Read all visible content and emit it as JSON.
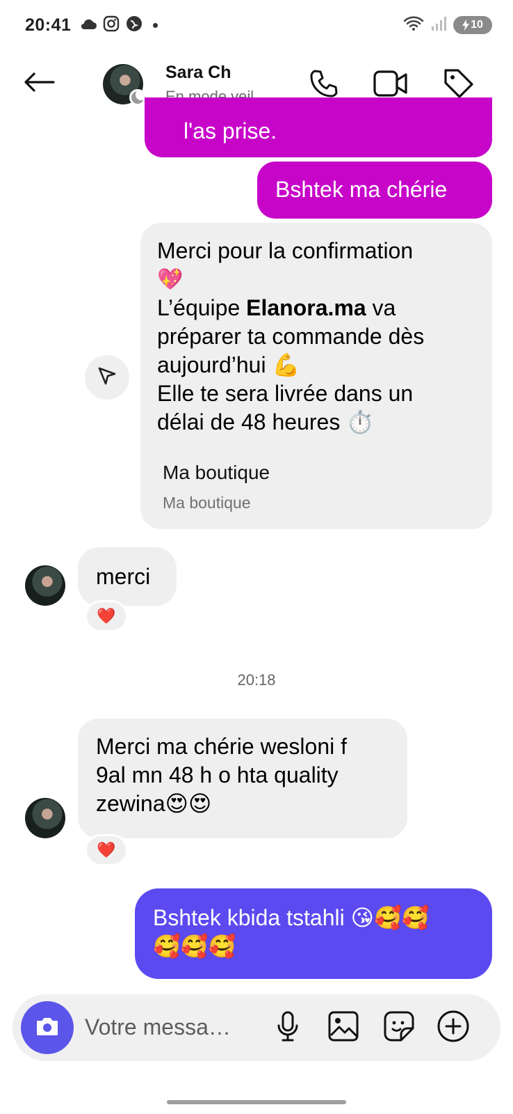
{
  "status_bar": {
    "time": "20:41",
    "battery": "10",
    "icons_left": [
      "cloud-icon",
      "instagram-icon",
      "vpn-icon"
    ],
    "icons_right": [
      "wifi-icon",
      "signal-icon",
      "battery-icon"
    ]
  },
  "header": {
    "name": "Sara Ch",
    "status": "En mode veil…",
    "icons": [
      "back-arrow-icon",
      "phone-icon",
      "video-icon",
      "tag-icon"
    ]
  },
  "messages": {
    "sent_partial": "l'as prise.",
    "sent_bshtek": "Bshtek ma chérie",
    "card": {
      "line1": "Merci pour la confirmation",
      "emoji_heart": "💖",
      "line2_pre": "L’équipe ",
      "line2_brand": "Elanora.ma",
      "line2_post": " va",
      "line3": "préparer ta commande dès",
      "line4": "aujourd’hui 💪",
      "line5": "Elle te sera livrée dans un",
      "line6": "délai de 48 heures ⏱️",
      "title": "Ma boutique",
      "subtitle": "Ma boutique"
    },
    "received_merci": "merci",
    "reaction_1": "❤️",
    "timestamp": "20:18",
    "received_long": "Merci ma chérie wesloni f\n9al mn 48 h o hta quality\nzewina😍😍",
    "reaction_2": "❤️",
    "sent_final": "Bshtek kbida tstahli 😘🥰🥰\n🥰🥰🥰"
  },
  "composer": {
    "placeholder": "Votre messa…",
    "icons": [
      "camera-icon",
      "microphone-icon",
      "image-icon",
      "sticker-icon",
      "plus-icon"
    ]
  },
  "colors": {
    "sent_pink": "#c705c9",
    "sent_purple": "#5b4af0",
    "received_bg": "#efefef",
    "camera_btn": "#5b55ea"
  }
}
